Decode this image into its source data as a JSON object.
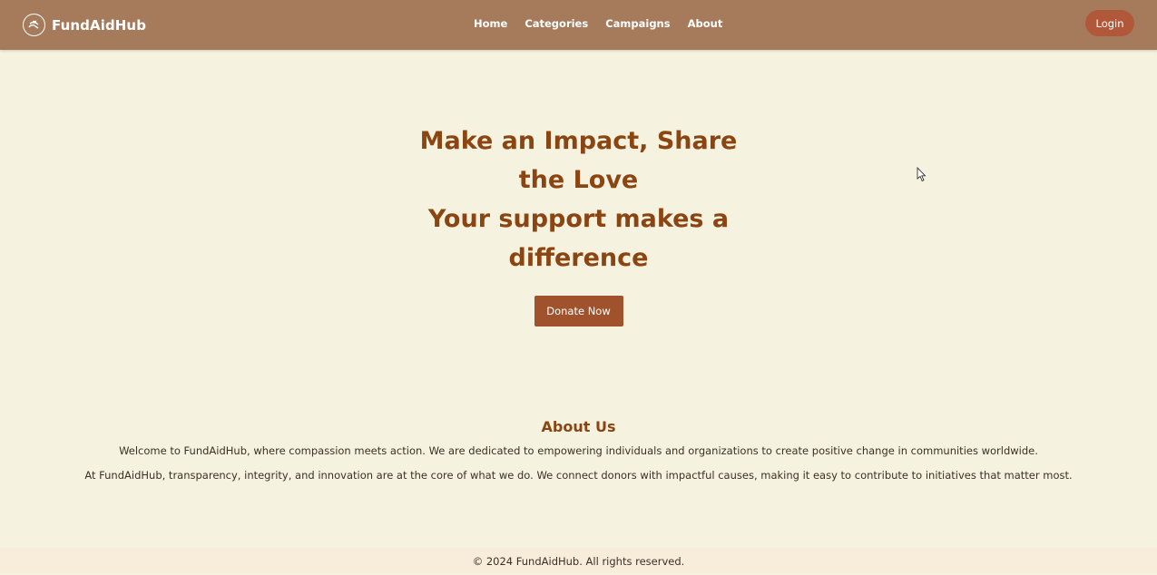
{
  "brand": {
    "name": "FundAidHub",
    "logo_icon": "heart-hands-icon"
  },
  "nav": {
    "items": [
      {
        "label": "Home"
      },
      {
        "label": "Categories"
      },
      {
        "label": "Campaigns"
      },
      {
        "label": "About"
      }
    ],
    "login_label": "Login"
  },
  "hero": {
    "title_line1": "Make an Impact, Share the Love",
    "title_line2": "Your support makes a difference",
    "cta_label": "Donate Now"
  },
  "about": {
    "title": "About Us",
    "paragraph1": "Welcome to FundAidHub, where compassion meets action. We are dedicated to empowering individuals and organizations to create positive change in communities worldwide.",
    "paragraph2": "At FundAidHub, transparency, integrity, and innovation are at the core of what we do. We connect donors with impactful causes, making it easy to contribute to initiatives that matter most."
  },
  "footer": {
    "copyright": "© 2024 FundAidHub. All rights reserved."
  },
  "colors": {
    "navbar": "#a57b5b",
    "page_background": "#f5f3df",
    "heading": "#8b4513",
    "button": "#a0522d",
    "login_button": "#b2583a",
    "footer": "#f8ecdb"
  }
}
